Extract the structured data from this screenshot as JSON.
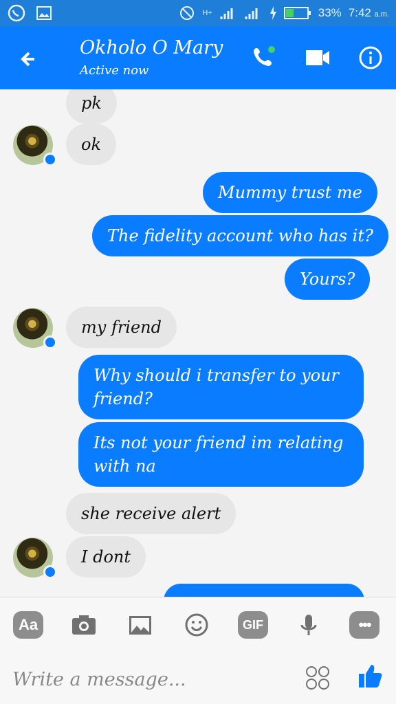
{
  "status": {
    "battery": "33%",
    "time": "7:42",
    "time_suffix": "a.m.",
    "network": "H+"
  },
  "header": {
    "contact_name": "Okholo O Mary",
    "status": "Active now"
  },
  "messages": [
    {
      "side": "in",
      "text": "pk"
    },
    {
      "side": "in",
      "text": "ok"
    },
    {
      "side": "out",
      "text": "Mummy trust me"
    },
    {
      "side": "out",
      "text": "The fidelity account who has it?"
    },
    {
      "side": "out",
      "text": "Yours?"
    },
    {
      "side": "in",
      "text": "my friend"
    },
    {
      "side": "out",
      "text": "Why should i transfer to your friend?"
    },
    {
      "side": "out",
      "text": "Its not your friend im relating with na"
    },
    {
      "side": "in",
      "text": "she receive alert"
    },
    {
      "side": "in",
      "text": "I dont"
    }
  ],
  "toolbar": {
    "aa_label": "Aa",
    "gif_label": "GIF",
    "more_label": "•••"
  },
  "composer": {
    "placeholder": "Write a message..."
  },
  "colors": {
    "brand": "#0a7cff",
    "incoming": "#e6e6e6"
  }
}
